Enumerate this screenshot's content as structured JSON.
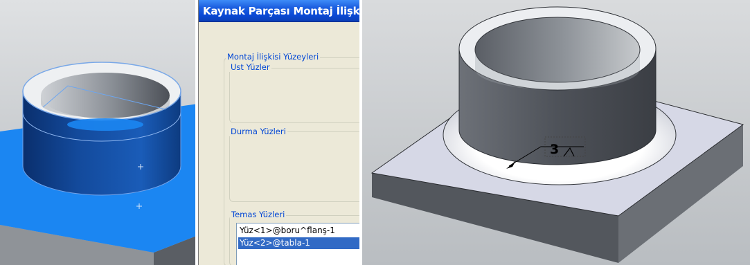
{
  "dialog": {
    "title": "Kaynak Parçası Montaj İlişk",
    "groups": {
      "mate_surfaces": "Montaj İlişkisi Yüzeyleri",
      "top_faces": "Ust Yüzler",
      "stop_faces": "Durma Yüzleri",
      "contact_faces": "Temas Yüzleri"
    },
    "contact_list": [
      "Yüz<1>@boru^flanş-1",
      "Yüz<2>@tabla-1"
    ],
    "selected_index": 1
  },
  "right_view": {
    "weld_symbol_size": "3"
  },
  "colors": {
    "viewport_bg_top": "#d8dadc",
    "viewport_bg_bottom": "#b4b8bc",
    "selection_blue": "#1b86f2",
    "title_blue": "#0a49d6",
    "list_selected": "#316ac5",
    "group_label": "#0046d5"
  },
  "icons": [
    "origin-plus-icon",
    "weld-arrow-icon"
  ]
}
